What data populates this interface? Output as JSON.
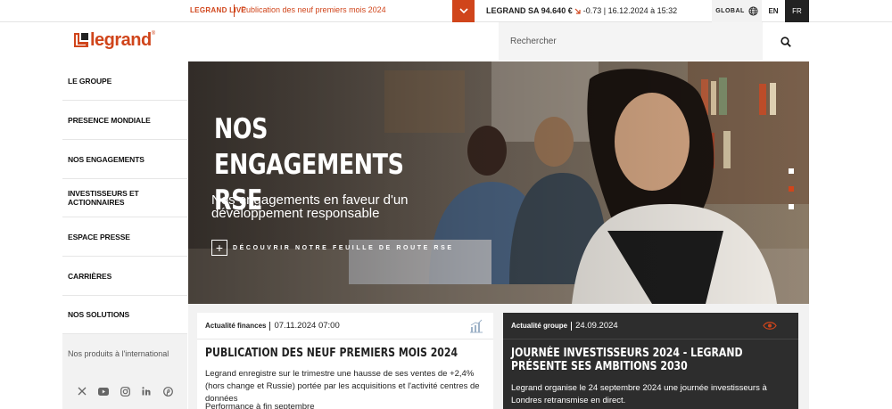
{
  "topbar": {
    "live_label": "LEGRAND LIVE",
    "live_news": "Publication des neuf premiers mois 2024",
    "stock_name": "LEGRAND SA 94.640 €",
    "stock_change": "-0.73",
    "stock_date": "| 16.12.2024 à 15:32",
    "global_label": "GLOBAL",
    "lang_en": "EN",
    "lang_fr": "FR",
    "accent_color": "#d0451b"
  },
  "header": {
    "logo_text": "legrand",
    "search_placeholder": "Rechercher"
  },
  "sidebar": {
    "items": [
      {
        "label": "LE GROUPE"
      },
      {
        "label": "PRESENCE MONDIALE"
      },
      {
        "label": "NOS ENGAGEMENTS"
      },
      {
        "label": "INVESTISSEURS ET ACTIONNAIRES"
      },
      {
        "label": "ESPACE PRESSE"
      },
      {
        "label": "CARRIÈRES"
      },
      {
        "label": "NOS SOLUTIONS"
      }
    ],
    "international": "Nos produits à l'international",
    "socials": [
      "x-icon",
      "youtube-icon",
      "instagram-icon",
      "linkedin-icon",
      "pinterest-icon"
    ]
  },
  "hero": {
    "title": "NOS ENGAGEMENTS RSE",
    "subtitle": "Nos engagements en faveur d'un développement responsable",
    "cta": "DÉCOUVRIR NOTRE FEUILLE DE ROUTE RSE",
    "slides": 3,
    "active_slide": 2
  },
  "news": [
    {
      "category": "Actualité finances",
      "date": "07.11.2024 07:00",
      "icon": "chart-icon",
      "title": "PUBLICATION DES NEUF PREMIERS MOIS 2024",
      "text": "Legrand enregistre sur le trimestre une hausse de ses ventes de +2,4% (hors change et Russie) portée par les acquisitions et l'activité centres de données",
      "text2": "Performance à fin septembre"
    },
    {
      "category": "Actualité groupe",
      "date": "24.09.2024",
      "icon": "eye-icon",
      "title": "JOURNÉE INVESTISSEURS 2024 - LEGRAND PRÉSENTE SES AMBITIONS 2030",
      "text": "Legrand organise le 24 septembre 2024 une journée investisseurs à Londres retransmise en direct."
    }
  ]
}
